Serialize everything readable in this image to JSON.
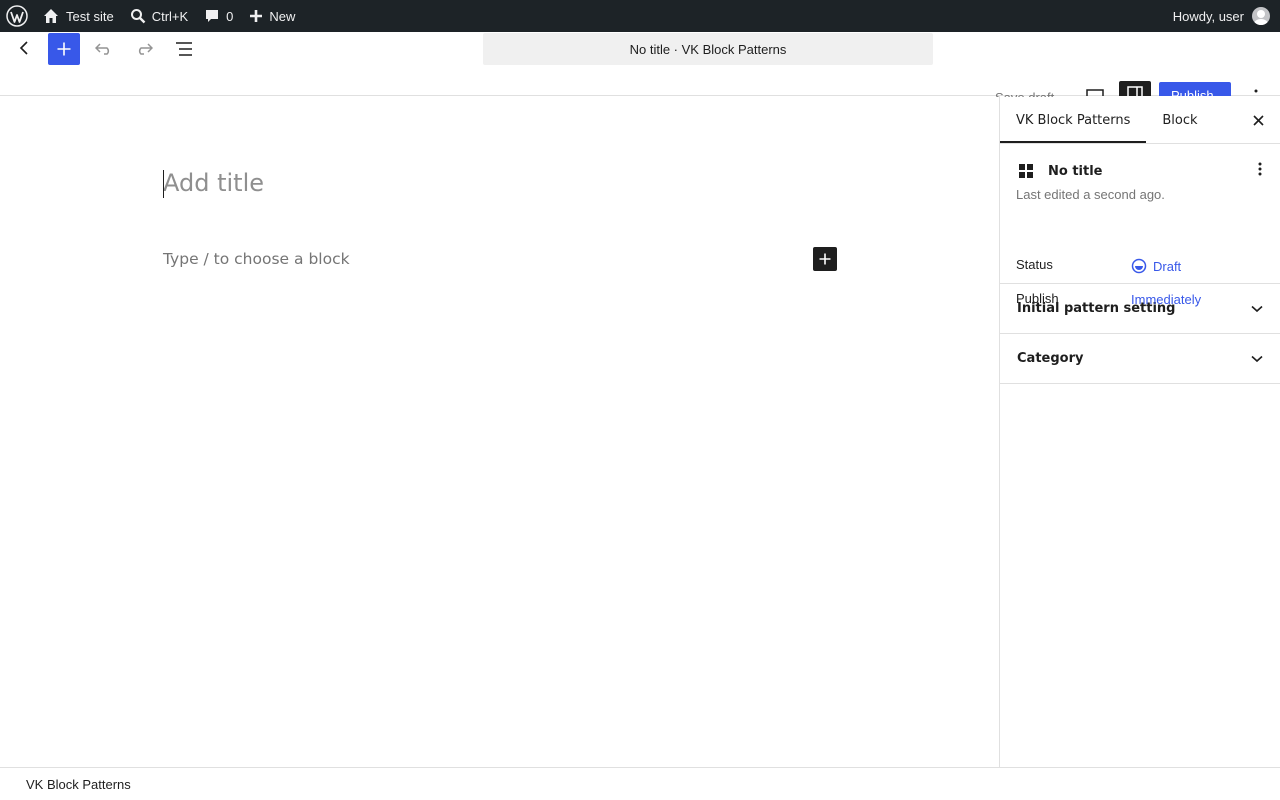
{
  "admin_bar": {
    "site_name": "Test site",
    "search_shortcut": "Ctrl+K",
    "comments_count": "0",
    "new_label": "New",
    "greeting": "Howdy, user"
  },
  "header": {
    "document_title": "No title · VK Block Patterns",
    "save_draft_label": "Save draft",
    "publish_label": "Publish"
  },
  "canvas": {
    "title_placeholder": "Add title",
    "block_placeholder": "Type / to choose a block"
  },
  "sidebar": {
    "tabs": [
      {
        "label": "VK Block Patterns",
        "active": true
      },
      {
        "label": "Block",
        "active": false
      }
    ],
    "post": {
      "title": "No title",
      "last_edited": "Last edited a second ago.",
      "status_label": "Status",
      "status_value": "Draft",
      "publish_label": "Publish",
      "publish_value": "Immediately"
    },
    "panels": [
      {
        "title": "Initial pattern setting"
      },
      {
        "title": "Category"
      }
    ]
  },
  "footer": {
    "breadcrumb": "VK Block Patterns"
  },
  "colors": {
    "accent": "#3858e9",
    "admin_bar_bg": "#1d2327",
    "dark": "#1e1e1e"
  }
}
